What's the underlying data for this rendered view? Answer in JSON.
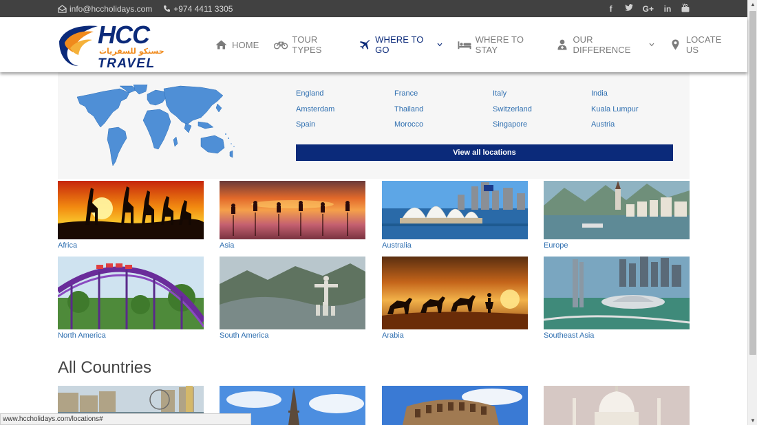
{
  "topbar": {
    "email": "info@hccholidays.com",
    "phone": "+974 4411 3305",
    "socials": [
      "f",
      "t",
      "G+",
      "in",
      "yt"
    ]
  },
  "logo": {
    "main": "HCC",
    "sub": "TRAVEL",
    "arabic": "حسنكو للسفريات"
  },
  "nav": [
    {
      "label": "HOME",
      "icon": "home-icon"
    },
    {
      "label": "TOUR TYPES",
      "icon": "bicycle-icon"
    },
    {
      "label": "WHERE TO GO",
      "icon": "plane-icon",
      "active": true,
      "has_caret": true
    },
    {
      "label": "WHERE TO STAY",
      "icon": "bed-icon"
    },
    {
      "label": "OUR DIFFERENCE",
      "icon": "user-icon",
      "has_caret": true
    },
    {
      "label": "LOCATE US",
      "icon": "map-marker-icon"
    }
  ],
  "mega": {
    "locations": [
      "England",
      "France",
      "Italy",
      "India",
      "Amsterdam",
      "Thailand",
      "Switzerland",
      "Kuala Lumpur",
      "Spain",
      "Morocco",
      "Singapore",
      "Austria"
    ],
    "view_all": "View all locations"
  },
  "regions": [
    {
      "label": "Africa",
      "scene": "sunset-giraffes"
    },
    {
      "label": "Asia",
      "scene": "stilt-fishermen"
    },
    {
      "label": "Australia",
      "scene": "opera-house"
    },
    {
      "label": "Europe",
      "scene": "lake-village"
    },
    {
      "label": "North America",
      "scene": "rollercoaster"
    },
    {
      "label": "South America",
      "scene": "rio-statue"
    },
    {
      "label": "Arabia",
      "scene": "camel-caravan"
    },
    {
      "label": "Southeast Asia",
      "scene": "singapore-bay"
    }
  ],
  "all_countries_title": "All Countries",
  "status_url": "www.hccholidays.com/locations#",
  "colors": {
    "brand_blue": "#0b2a7a",
    "link_blue": "#2f6fb0",
    "logo_orange": "#f08a1c",
    "topbar": "#414141"
  }
}
